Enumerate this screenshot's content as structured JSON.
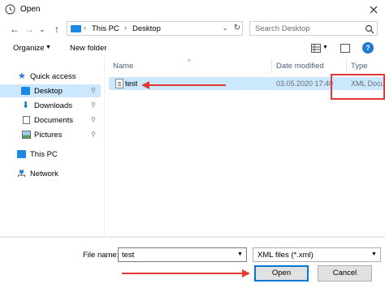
{
  "window": {
    "title": "Open",
    "title_icon": "open-dialog-icon",
    "close_glyph": "×"
  },
  "nav": {
    "back_glyph": "←",
    "forward_glyph": "→",
    "recent_glyph": "⌄",
    "up_glyph": "↑",
    "breadcrumbs": [
      "This PC",
      "Desktop"
    ],
    "breadcrumb_separator": "›",
    "address_dropdown_glyph": "⌄",
    "refresh_glyph": "↻"
  },
  "search": {
    "placeholder": "Search Desktop"
  },
  "toolbar": {
    "organize_label": "Organize",
    "new_folder_label": "New folder",
    "help_glyph": "?"
  },
  "sidebar": {
    "items": [
      {
        "label": "Quick access",
        "icon": "star-icon"
      },
      {
        "label": "Desktop",
        "icon": "desktop-icon",
        "pinned": true,
        "selected": true
      },
      {
        "label": "Downloads",
        "icon": "download-icon",
        "pinned": true
      },
      {
        "label": "Documents",
        "icon": "document-icon",
        "pinned": true
      },
      {
        "label": "Pictures",
        "icon": "pictures-icon",
        "pinned": true
      },
      {
        "label": "This PC",
        "icon": "computer-icon"
      },
      {
        "label": "Network",
        "icon": "network-icon"
      }
    ],
    "pin_glyph": "📌"
  },
  "columns": {
    "name": "Name",
    "date_modified": "Date modified",
    "type": "Type"
  },
  "files": [
    {
      "name": "test",
      "date_modified": "03.05.2020 17:40",
      "type": "XML Docu",
      "selected": true
    }
  ],
  "footer": {
    "file_name_label": "File name:",
    "file_name_value": "test",
    "filter_value": "XML files (*.xml)",
    "open_label": "Open",
    "cancel_label": "Cancel"
  },
  "colors": {
    "accent": "#0078d7",
    "selection": "#cce8ff",
    "annotation": "#e53935"
  }
}
